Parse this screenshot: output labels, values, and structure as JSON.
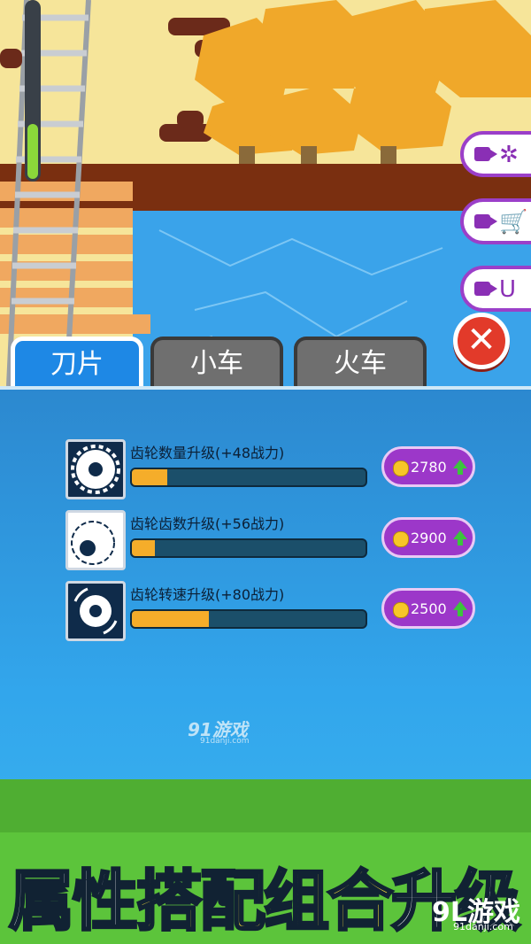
{
  "tabs": [
    {
      "label": "刀片",
      "active": true
    },
    {
      "label": "小车",
      "active": false
    },
    {
      "label": "火车",
      "active": false
    }
  ],
  "upgrades": [
    {
      "label": "齿轮数量升级(+48战力)",
      "progress": 0.15,
      "price": "2780",
      "icon": "saw-blade-multi-icon"
    },
    {
      "label": "齿轮齿数升级(+56战力)",
      "progress": 0.1,
      "price": "2900",
      "icon": "saw-blade-teeth-icon"
    },
    {
      "label": "齿轮转速升级(+80战力)",
      "progress": 0.33,
      "price": "2500",
      "icon": "saw-blade-spin-icon"
    }
  ],
  "side_buttons": [
    {
      "icon": "saw-blade-icon",
      "symbol": "✲"
    },
    {
      "icon": "cart-icon",
      "symbol": "🛒"
    },
    {
      "icon": "magnet-icon",
      "symbol": "U"
    }
  ],
  "close_symbol": "✕",
  "watermark": {
    "text": "91游戏",
    "sub": "91danji.com"
  },
  "banner": {
    "part1": "属性",
    "part2": "搭配组合",
    "part3": "升级"
  },
  "logo": {
    "text": "9L游戏",
    "sub": "91danji.com"
  },
  "colors": {
    "accent": "#9c37c9",
    "bar_fill": "#f5ad2a",
    "panel": "#2c88cf"
  }
}
